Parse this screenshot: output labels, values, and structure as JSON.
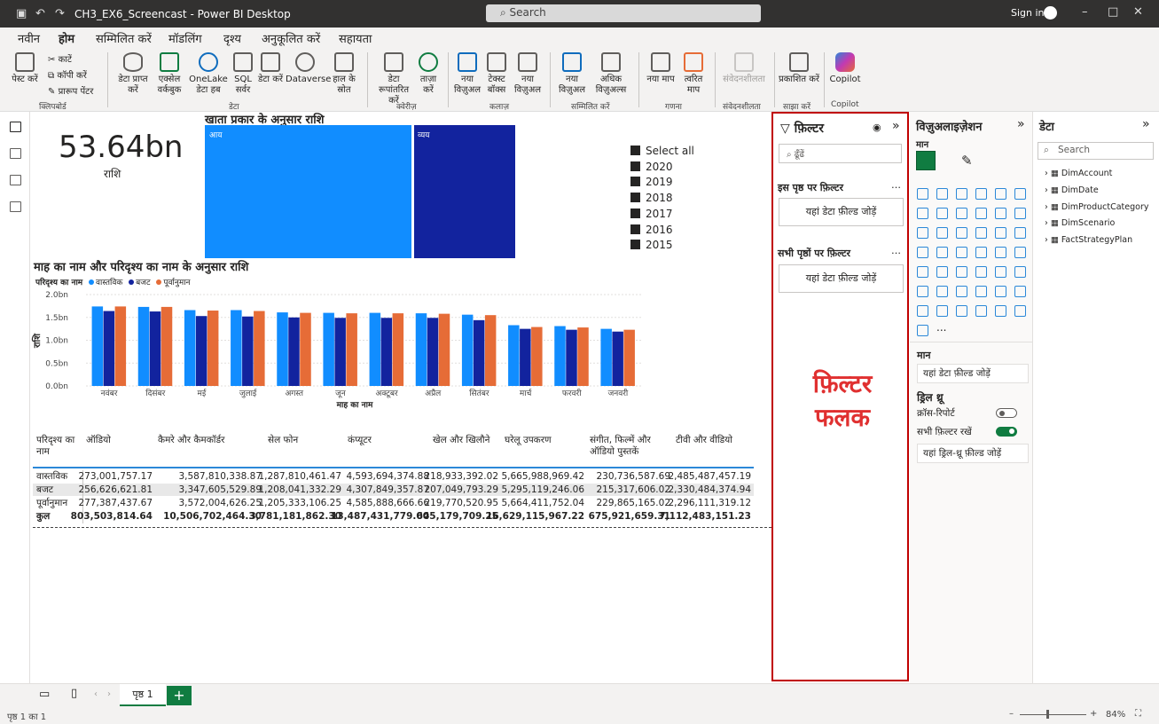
{
  "titlebar": {
    "title": "CH3_EX6_Screencast - Power BI Desktop",
    "search_placeholder": "Search",
    "signin": "Sign in"
  },
  "menu": {
    "items": [
      "नवीन",
      "होम",
      "सम्मिलित करें",
      "मॉडलिंग",
      "दृश्य",
      "अनुकूलित करें",
      "सहायता"
    ],
    "active": "होम"
  },
  "ribbon": {
    "paste": "पेस्ट करें",
    "cut": "काटें",
    "copy": "कॉपी करें",
    "format_painter": "प्रारूप पेंटर",
    "clipboard_group": "क्लिपबोर्ड",
    "get_data": "डेटा प्राप्त करें",
    "excel": "एक्सेल वर्कबुक",
    "onelake": "OneLake डेटा हब",
    "sql": "SQL सर्वर",
    "enter_data": "डेटा करें",
    "dataverse": "Dataverse",
    "recent": "हाल के स्रोत",
    "data_group": "डेटा",
    "transform": "डेटा रूपांतरित करें",
    "refresh": "ताज़ा करें",
    "queries_group": "क्वेरीज़",
    "new_visual_small": "नया विज़ुअल",
    "text_box": "टेक्स्ट बॉक्स",
    "more_visuals_small": "नया विज़ुअल",
    "canvas_group": "कलाज़",
    "new_visual": "नया विज़ुअल",
    "more_visuals": "अधिक विज़ुअल्स",
    "insert_group": "सम्मिलित करें",
    "new_measure": "नया माप",
    "quick_measure": "त्वरित माप",
    "calc_group": "गणना",
    "sensitivity": "संवेदनशीलता",
    "sensitivity_group": "संवेदनशीलता",
    "publish": "प्रकाशित करें",
    "share_group": "साझा करें",
    "copilot": "Copilot",
    "copilot_group": "Copilot"
  },
  "kpi": {
    "value": "53.64bn",
    "label": "राशि"
  },
  "treemap": {
    "title": "खाता प्रकार के अनुसार राशि",
    "tiles": [
      {
        "label": "आय",
        "color": "#118dff"
      },
      {
        "label": "व्यय",
        "color": "#12239e"
      }
    ]
  },
  "slicer": {
    "items": [
      "Select all",
      "2020",
      "2019",
      "2018",
      "2017",
      "2016",
      "2015"
    ]
  },
  "chart_title": "माह का नाम और परिदृश्य का नाम के अनुसार राशि",
  "legend": {
    "title": "परिदृश्य का नाम"
  },
  "chart_data": {
    "type": "bar",
    "title": "माह का नाम और परिदृश्य का नाम के अनुसार राशि",
    "xlabel": "माह का नाम",
    "ylabel": "राशि",
    "ylim": [
      0,
      2.0
    ],
    "yticks": [
      "0.0bn",
      "0.5bn",
      "1.0bn",
      "1.5bn",
      "2.0bn"
    ],
    "grid": true,
    "legend_position": "top-left",
    "categories": [
      "नवंबर",
      "दिसंबर",
      "मई",
      "जुलाई",
      "अगस्त",
      "जून",
      "अक्टूबर",
      "अप्रैल",
      "सितंबर",
      "मार्च",
      "फरवरी",
      "जनवरी"
    ],
    "series": [
      {
        "name": "वास्तविक",
        "color": "#118dff",
        "values": [
          1.74,
          1.73,
          1.66,
          1.66,
          1.61,
          1.6,
          1.6,
          1.59,
          1.56,
          1.33,
          1.31,
          1.25
        ]
      },
      {
        "name": "बजट",
        "color": "#12239e",
        "values": [
          1.64,
          1.63,
          1.53,
          1.52,
          1.5,
          1.49,
          1.49,
          1.49,
          1.44,
          1.25,
          1.23,
          1.19
        ]
      },
      {
        "name": "पूर्वानुमान",
        "color": "#e66c37",
        "values": [
          1.74,
          1.73,
          1.65,
          1.64,
          1.6,
          1.59,
          1.59,
          1.58,
          1.55,
          1.29,
          1.28,
          1.23
        ]
      }
    ]
  },
  "matrix": {
    "headers": [
      "परिदृश्य का नाम",
      "ऑडियो",
      "कैमरे और कैमकॉर्डर",
      "सेल फोन",
      "कंप्यूटर",
      "खेल और खिलौने",
      "घरेलू उपकरण",
      "संगीत, फिल्में और ऑडियो पुस्तकें",
      "टीवी और वीडियो"
    ],
    "rows": [
      {
        "name": "वास्तविक",
        "values": [
          "273,001,757.17",
          "3,587,810,338.87",
          "1,287,810,461.47",
          "4,593,694,374.88",
          "218,933,392.02",
          "5,665,988,969.42",
          "230,736,587.69",
          "2,485,487,457.19"
        ]
      },
      {
        "name": "बजट",
        "values": [
          "256,626,621.81",
          "3,347,605,529.89",
          "1,208,041,332.29",
          "4,307,849,357.87",
          "207,049,793.29",
          "5,295,119,246.06",
          "215,317,606.02",
          "2,330,484,374.94"
        ]
      },
      {
        "name": "पूर्वानुमान",
        "values": [
          "277,387,437.67",
          "3,572,004,626.25",
          "1,205,333,106.25",
          "4,585,888,666.66",
          "219,770,520.95",
          "5,664,411,752.04",
          "229,865,165.02",
          "2,296,111,319.12"
        ]
      }
    ],
    "total": {
      "name": "कुल",
      "values": [
        "803,503,814.64",
        "10,506,702,464.30",
        "3,781,181,862.30",
        "13,487,431,779.00",
        "645,179,709.25",
        "16,629,115,967.22",
        "675,921,659.31",
        "7,112,483,151.23"
      ]
    }
  },
  "filter_pane": {
    "title": "फ़िल्टर",
    "search_placeholder": "ढूँढें",
    "page_section": "इस पृष्ठ पर फ़िल्टर",
    "all_section": "सभी पृष्ठों पर फ़िल्टर",
    "well": "यहां डेटा फ़ील्ड जोड़ें",
    "annotation_line1": "फ़िल्टर",
    "annotation_line2": "फलक"
  },
  "viz_pane": {
    "title": "विज़ुअलाइज़ेशन",
    "build_label": "मान",
    "values_label": "मान",
    "values_well": "यहां डेटा फ़ील्ड जोड़ें",
    "drill_label": "ड्रिल थ्रू",
    "cross_report": "क्रॉस-रिपोर्ट",
    "cross_report_state": "बंद",
    "keep_filters": "सभी फ़िल्टर रखें",
    "keep_filters_state": "चालू",
    "drill_well": "यहां ड्रिल-थ्रू फ़ील्ड जोड़ें",
    "more": "..."
  },
  "data_pane": {
    "title": "डेटा",
    "search_placeholder": "Search",
    "tables": [
      "DimAccount",
      "DimDate",
      "DimProductCategory",
      "DimScenario",
      "FactStrategyPlan"
    ]
  },
  "pages": {
    "tab": "पृष्ठ 1",
    "add": "+"
  },
  "status": {
    "page": "पृष्ठ 1 का 1",
    "zoom": "84%"
  }
}
